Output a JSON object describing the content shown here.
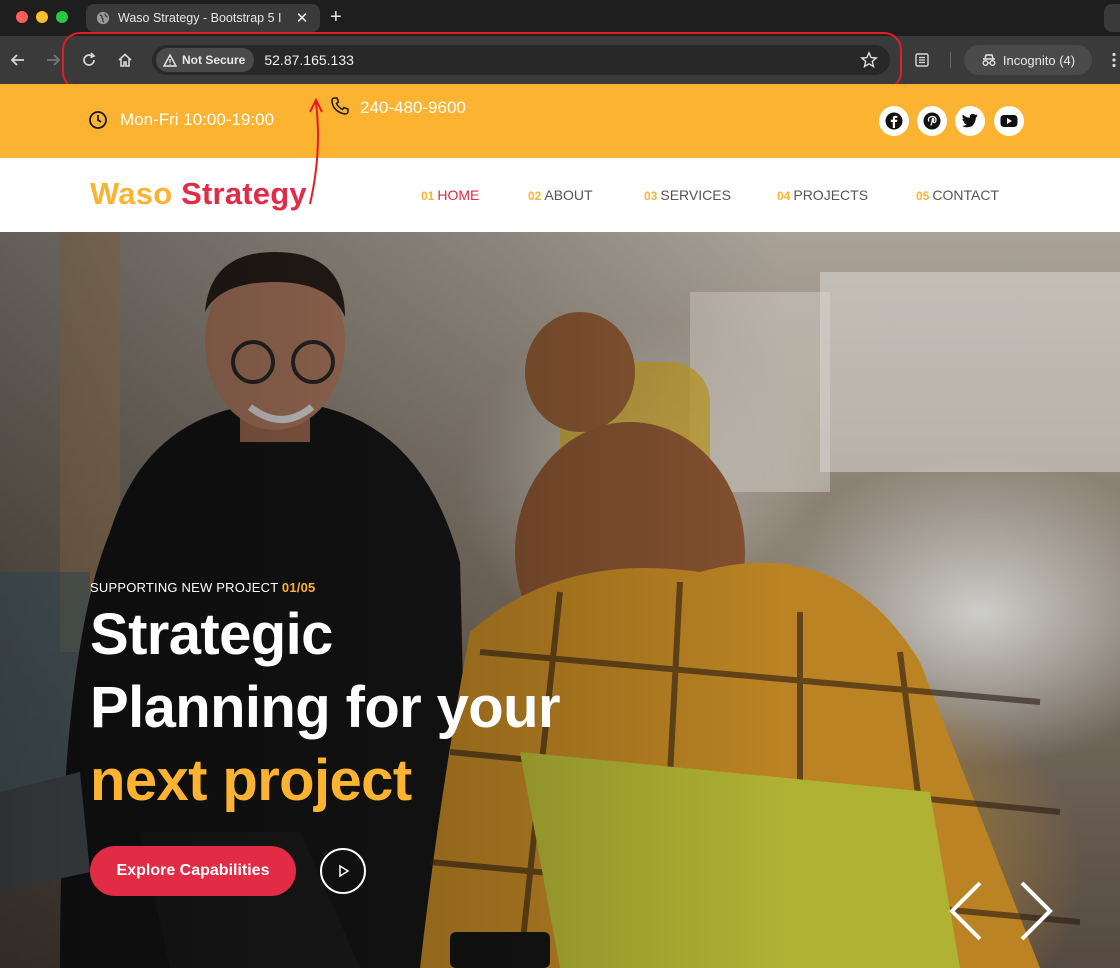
{
  "browser": {
    "tab_title": "Waso Strategy - Bootstrap 5 I",
    "security_label": "Not Secure",
    "url": "52.87.165.133",
    "incognito_label": "Incognito (4)"
  },
  "topbar": {
    "hours": "Mon-Fri 10:00-19:00",
    "phone": "240-480-9600",
    "social": [
      "facebook-icon",
      "pinterest-icon",
      "twitter-icon",
      "youtube-icon"
    ]
  },
  "brand": {
    "part1": "Waso",
    "part2": "Strategy"
  },
  "nav": [
    {
      "num": "01",
      "label": "HOME",
      "active": true
    },
    {
      "num": "02",
      "label": "ABOUT",
      "active": false
    },
    {
      "num": "03",
      "label": "SERVICES",
      "active": false
    },
    {
      "num": "04",
      "label": "PROJECTS",
      "active": false
    },
    {
      "num": "05",
      "label": "CONTACT",
      "active": false
    }
  ],
  "hero": {
    "kicker": "SUPPORTING NEW PROJECT",
    "slide_counter": "01/05",
    "title_line1": "Strategic",
    "title_line2": "Planning for your",
    "title_accent": "next project",
    "cta_label": "Explore Capabilities"
  },
  "colors": {
    "accent_yellow": "#fbb331",
    "accent_red": "#e22b45",
    "annotation_red": "#e31c25"
  }
}
